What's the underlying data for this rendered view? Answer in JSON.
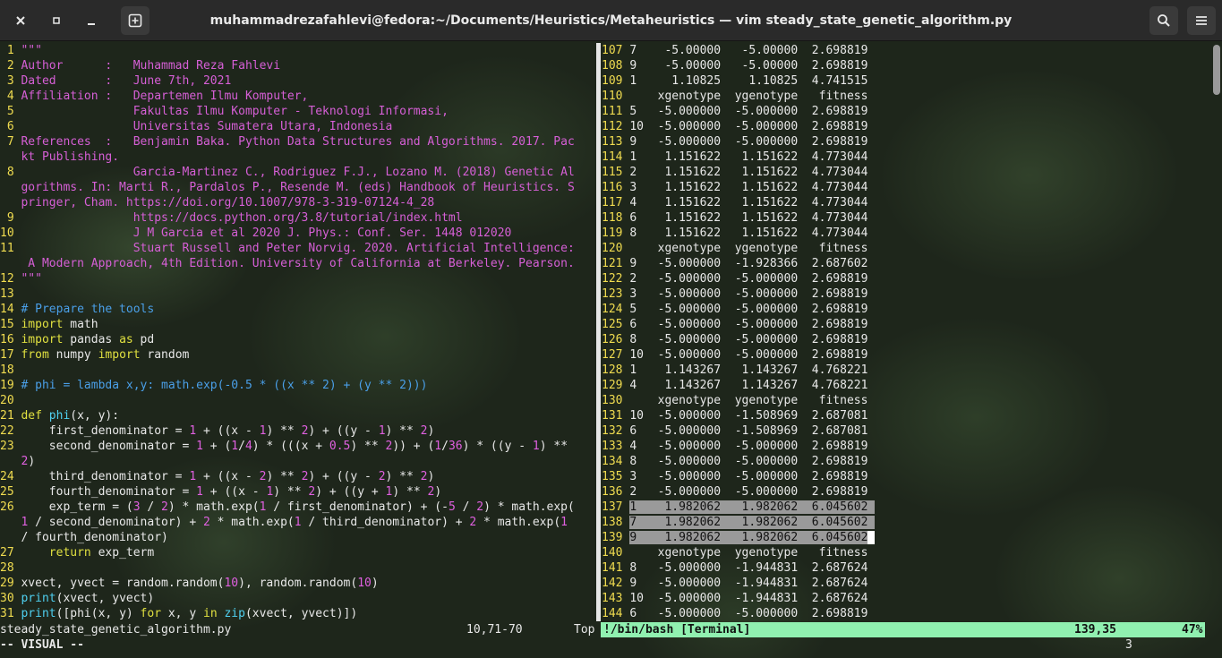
{
  "window": {
    "title": "muhammadrezafahlevi@fedora:~/Documents/Heuristics/Metaheuristics — vim steady_state_genetic_algorithm.py",
    "close_icon": "close-icon",
    "maximize_icon": "maximize-icon",
    "minimize_icon": "minimize-icon",
    "new_tab_icon": "new-tab-icon",
    "search_icon": "search-icon",
    "menu_icon": "hamburger-menu-icon"
  },
  "left_status": {
    "filename": "steady_state_genetic_algorithm.py",
    "position": "10,71-70",
    "scroll": "Top"
  },
  "right_status": {
    "buffer": "!/bin/bash [Terminal]",
    "position": "139,35",
    "percent": "47%"
  },
  "cmdline": {
    "mode": "-- VISUAL --",
    "count": "3"
  },
  "colors": {
    "accent_status": "#90f0b0",
    "line_number": "#f0dc50",
    "comment": "#4a9fe8",
    "string": "#d65fd6",
    "keyword": "#e0e040"
  }
}
